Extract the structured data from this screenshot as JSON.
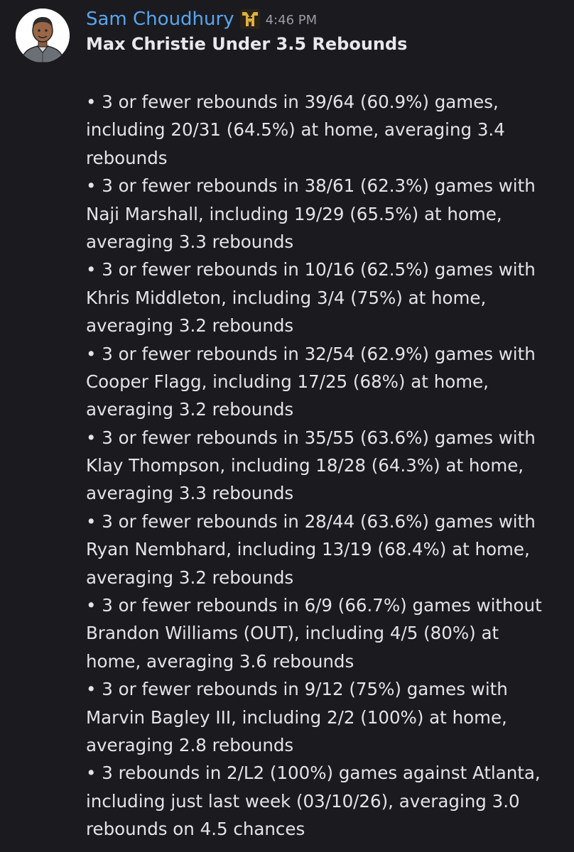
{
  "message": {
    "author": "Sam Choudhury",
    "badge_icon": "mf-logo-badge-icon",
    "badge_color": "#e0b040",
    "username_color": "#58a6f0",
    "timestamp": "4:46 PM",
    "title": "Max Christie Under 3.5 Rebounds",
    "lines": [
      "• 3 or fewer rebounds in 39/64 (60.9%) games,",
      "including 20/31 (64.5%) at home, averaging 3.4",
      "rebounds",
      "• 3 or fewer rebounds in 38/61 (62.3%) games with",
      "Naji Marshall, including 19/29 (65.5%) at home,",
      "averaging 3.3 rebounds",
      "• 3 or fewer rebounds in 10/16 (62.5%) games with",
      "Khris Middleton, including 3/4 (75%) at home,",
      "averaging 3.2 rebounds",
      "• 3 or fewer rebounds in 32/54 (62.9%) games with",
      "Cooper Flagg, including 17/25 (68%) at home,",
      "averaging 3.2 rebounds",
      "• 3 or fewer rebounds in 35/55 (63.6%) games with",
      "Klay Thompson, including 18/28 (64.3%) at home,",
      "averaging 3.3 rebounds",
      "• 3 or fewer rebounds in 28/44 (63.6%) games with",
      "Ryan Nembhard, including 13/19 (68.4%) at home,",
      "averaging 3.2 rebounds",
      "• 3 or fewer rebounds in 6/9 (66.7%) games without",
      "Brandon Williams (OUT), including 4/5 (80%) at",
      "home, averaging 3.6 rebounds",
      "• 3 or fewer rebounds in 9/12 (75%) games with",
      "Marvin Bagley III, including 2/2 (100%) at home,",
      "averaging 2.8 rebounds",
      "• 3 rebounds in 2/L2 (100%) games against Atlanta,",
      "including just last week (03/10/26), averaging 3.0",
      "rebounds on 4.5 chances"
    ]
  }
}
